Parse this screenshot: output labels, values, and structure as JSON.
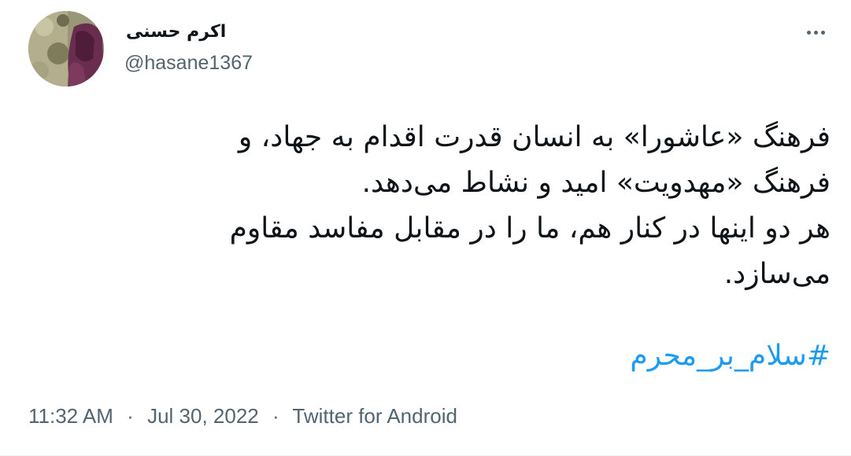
{
  "user": {
    "display_name": "اکرم حسنی",
    "handle": "@hasane1367",
    "avatar_icon": "profile-photo"
  },
  "more_icon": "more-horizontal-icon",
  "tweet": {
    "lines": [
      "فرهنگ «عاشورا» به انسان قدرت اقدام به جهاد، و",
      "فرهنگ «مهدویت» امید و نشاط می‌دهد.",
      "هر دو اینها در کنار هم، ما را در مقابل مفاسد مقاوم",
      "می‌سازد."
    ],
    "hashtag": "#سلام_بر_محرم"
  },
  "meta": {
    "time": "11:32 AM",
    "date": "Jul 30, 2022",
    "source": "Twitter for Android",
    "separator": "·"
  },
  "colors": {
    "link": "#1d9bf0",
    "secondary_text": "#536471",
    "primary_text": "#0f1419"
  }
}
